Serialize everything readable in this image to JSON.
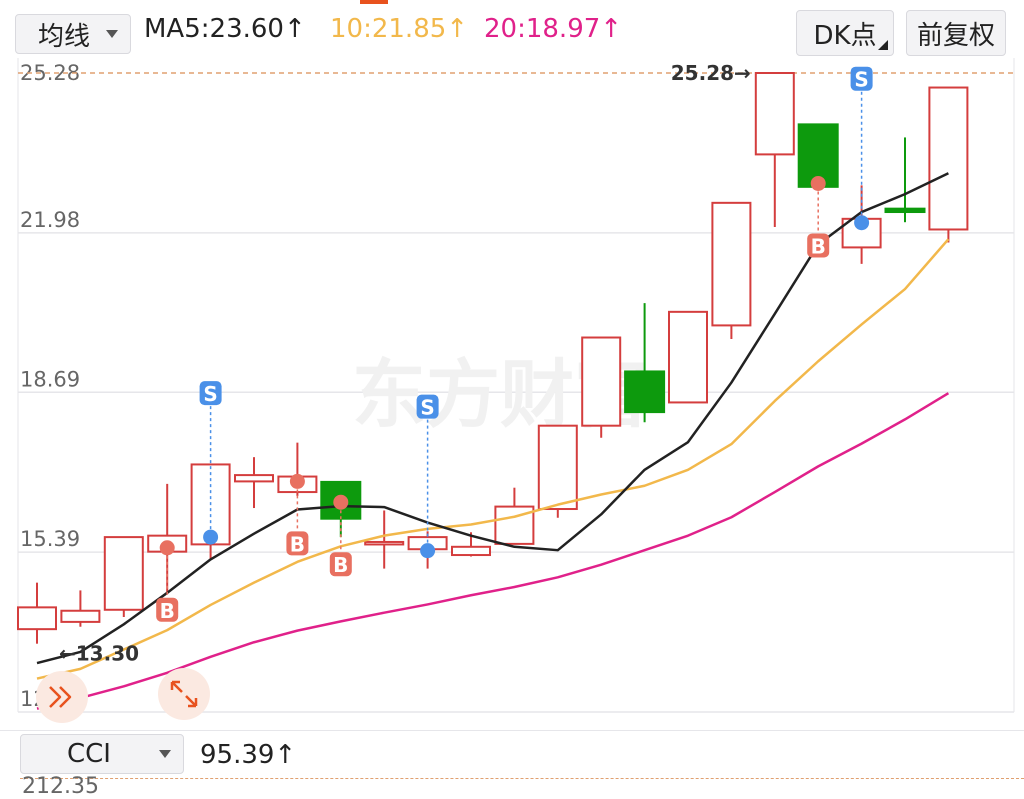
{
  "toolbar": {
    "ma_selector": "均线",
    "ma_legend": [
      {
        "text": "MA5:23.60↑",
        "color": "#222222"
      },
      {
        "text": "10:21.85↑",
        "color": "#f2b84b"
      },
      {
        "text": "20:18.97↑",
        "color": "#e0218a"
      }
    ],
    "dk_button": "DK点",
    "fq_button": "前复权"
  },
  "indicator": {
    "selector": "CCI",
    "value": "95.39↑",
    "next_axis_label": "212.35"
  },
  "watermark": "东方财富",
  "chart_data": {
    "type": "candlestick",
    "ylim": [
      12.09,
      25.28
    ],
    "y_ticks": [
      "25.28",
      "21.98",
      "18.69",
      "15.39",
      "12.09"
    ],
    "y_tick_values": [
      25.28,
      21.98,
      18.69,
      15.39,
      12.09
    ],
    "max_label": "25.28→",
    "min_label": "←13.30",
    "max_value": 25.28,
    "min_value": 13.3,
    "colors": {
      "up": "#d43d3d",
      "down": "#0d9a0d",
      "ma5": "#222222",
      "ma10": "#f2b84b",
      "ma20": "#e0218a",
      "dash": "#e0a070"
    },
    "candles": [
      {
        "o": 13.8,
        "c": 14.25,
        "h": 14.76,
        "l": 13.5
      },
      {
        "o": 13.95,
        "c": 14.18,
        "h": 14.6,
        "l": 13.85
      },
      {
        "o": 14.2,
        "c": 15.7,
        "h": 15.7,
        "l": 14.05
      },
      {
        "o": 15.4,
        "c": 15.73,
        "h": 16.8,
        "l": 14.55
      },
      {
        "o": 15.55,
        "c": 17.2,
        "h": 17.2,
        "l": 15.25
      },
      {
        "o": 16.85,
        "c": 16.98,
        "h": 17.35,
        "l": 16.3
      },
      {
        "o": 16.63,
        "c": 16.95,
        "h": 17.65,
        "l": 16.55
      },
      {
        "o": 16.85,
        "c": 16.07,
        "h": 16.85,
        "l": 15.7
      },
      {
        "o": 15.55,
        "c": 15.6,
        "h": 16.25,
        "l": 15.05
      },
      {
        "o": 15.45,
        "c": 15.7,
        "h": 15.82,
        "l": 15.05
      },
      {
        "o": 15.33,
        "c": 15.5,
        "h": 15.8,
        "l": 15.3
      },
      {
        "o": 15.56,
        "c": 16.33,
        "h": 16.72,
        "l": 15.56
      },
      {
        "o": 16.28,
        "c": 18.0,
        "h": 18.0,
        "l": 16.1
      },
      {
        "o": 18.0,
        "c": 19.82,
        "h": 19.82,
        "l": 17.75
      },
      {
        "o": 19.13,
        "c": 18.27,
        "h": 20.53,
        "l": 18.07
      },
      {
        "o": 18.48,
        "c": 20.35,
        "h": 20.35,
        "l": 18.48
      },
      {
        "o": 20.07,
        "c": 22.6,
        "h": 22.6,
        "l": 19.79
      },
      {
        "o": 23.6,
        "c": 25.28,
        "h": 25.28,
        "l": 22.1
      },
      {
        "o": 24.23,
        "c": 22.92,
        "h": 24.23,
        "l": 22.92
      },
      {
        "o": 21.68,
        "c": 22.27,
        "h": 22.96,
        "l": 21.34
      },
      {
        "o": 22.49,
        "c": 22.4,
        "h": 23.95,
        "l": 22.2
      },
      {
        "o": 22.05,
        "c": 24.98,
        "h": 24.98,
        "l": 21.78
      }
    ],
    "ma5": [
      13.1,
      13.33,
      13.9,
      14.55,
      15.24,
      15.77,
      16.27,
      16.34,
      16.32,
      16.0,
      15.73,
      15.5,
      15.43,
      16.17,
      17.09,
      17.66,
      18.89,
      20.31,
      21.74,
      22.41,
      22.78,
      23.21
    ],
    "ma10": [
      12.78,
      12.98,
      13.38,
      13.78,
      14.3,
      14.76,
      15.19,
      15.51,
      15.73,
      15.87,
      15.96,
      16.12,
      16.37,
      16.58,
      16.76,
      17.09,
      17.62,
      18.51,
      19.33,
      20.09,
      20.82,
      21.85
    ],
    "ma20": [
      12.16,
      12.38,
      12.62,
      12.9,
      13.23,
      13.53,
      13.77,
      13.96,
      14.14,
      14.31,
      14.5,
      14.67,
      14.87,
      15.13,
      15.43,
      15.73,
      16.11,
      16.63,
      17.16,
      17.63,
      18.13,
      18.67
    ],
    "signals": [
      {
        "i": 3,
        "type": "B",
        "marker": 15.48
      },
      {
        "i": 4,
        "type": "S",
        "marker": 15.7
      },
      {
        "i": 6,
        "type": "B",
        "marker": 16.85
      },
      {
        "i": 7,
        "type": "B",
        "marker": 16.42
      },
      {
        "i": 9,
        "type": "S",
        "marker": 15.42
      },
      {
        "i": 18,
        "type": "B",
        "marker": 23.0
      },
      {
        "i": 19,
        "type": "S",
        "marker": 22.19
      }
    ]
  }
}
